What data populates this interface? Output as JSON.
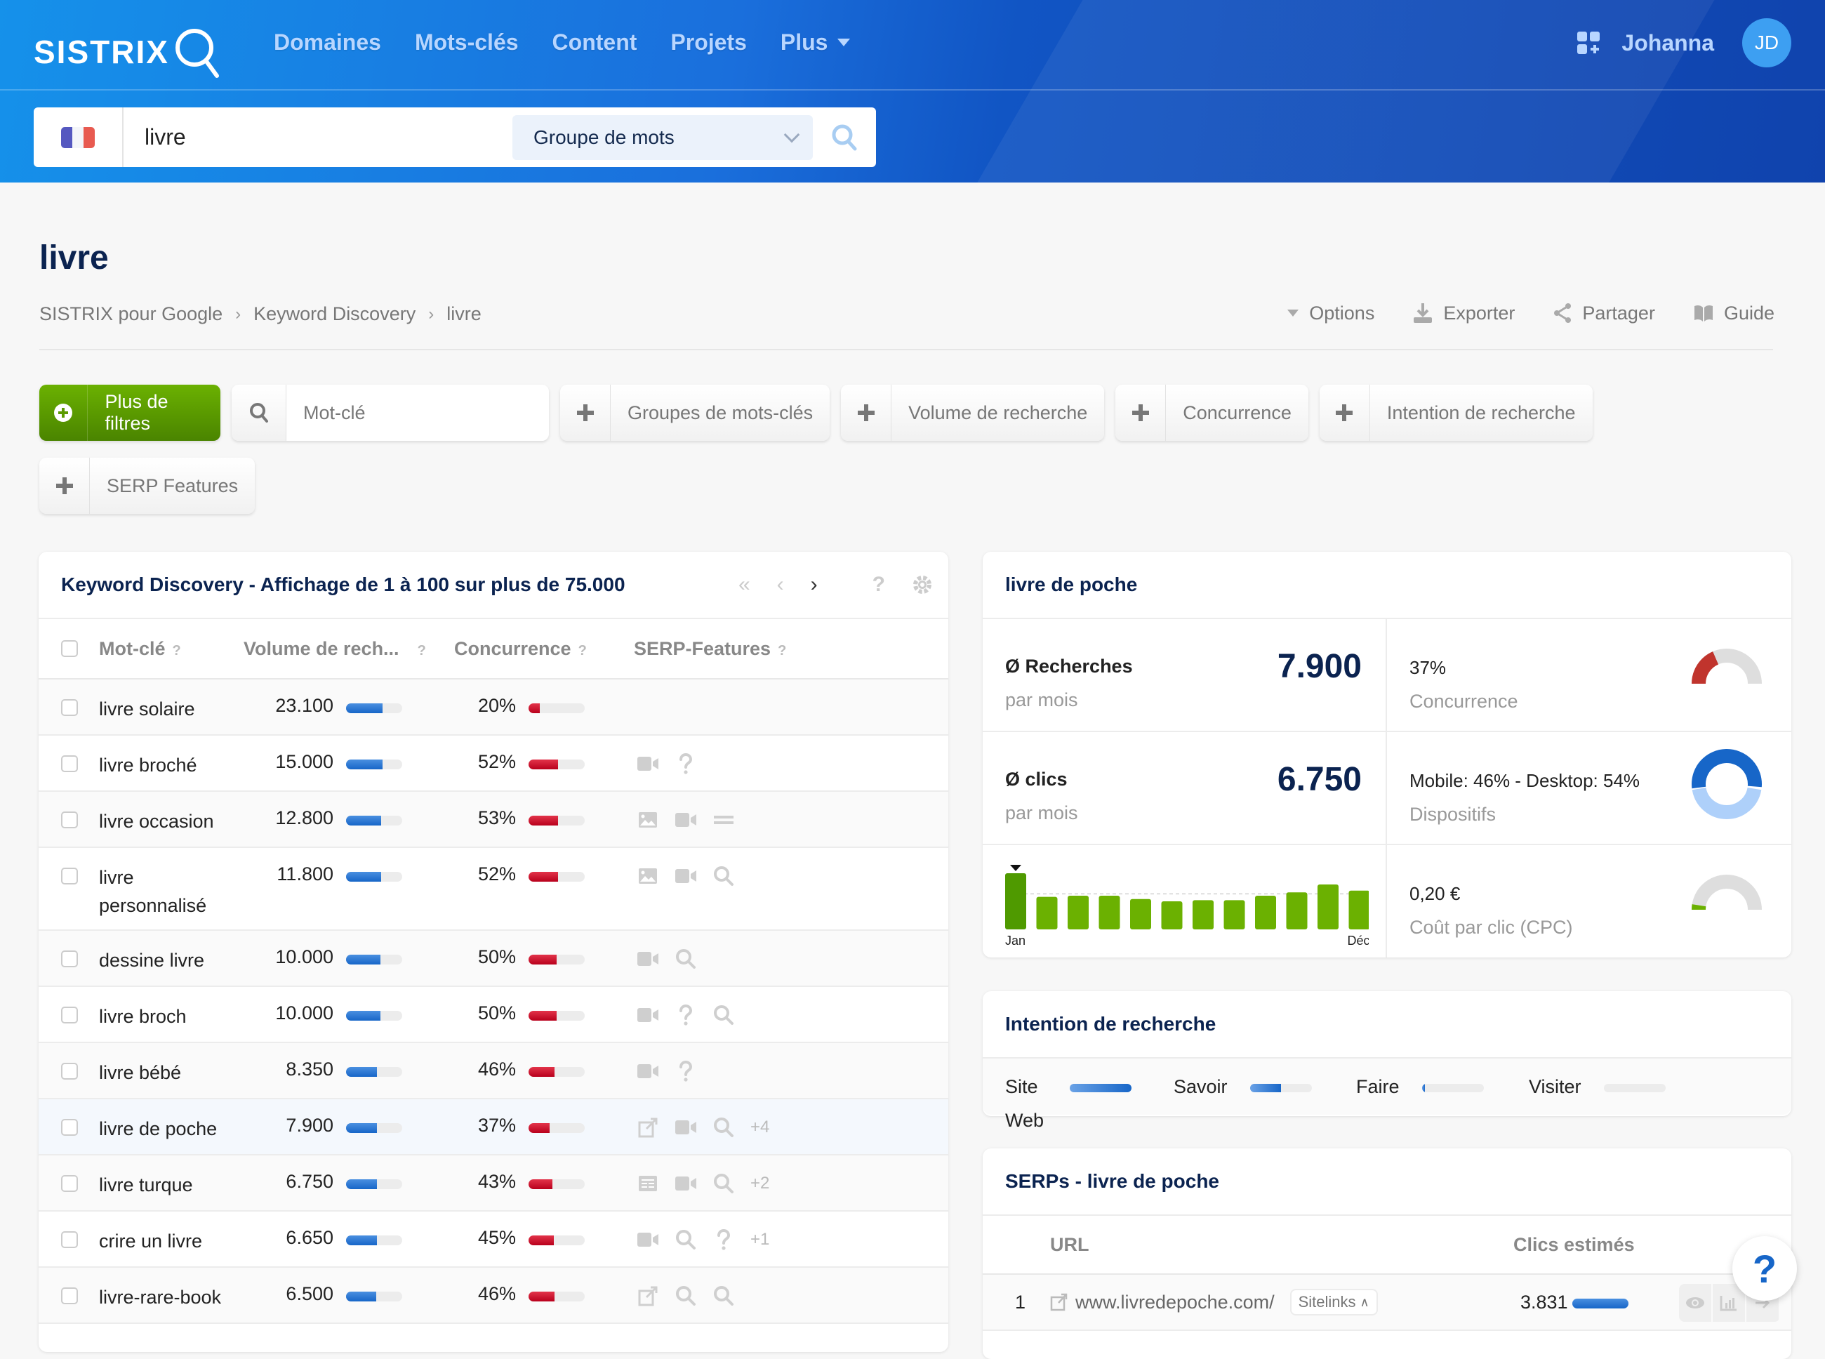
{
  "header": {
    "logo_text": "SISTRIX",
    "nav": [
      {
        "label": "Domaines"
      },
      {
        "label": "Mots-clés"
      },
      {
        "label": "Content"
      },
      {
        "label": "Projets"
      },
      {
        "label": "Plus",
        "has_dropdown": true
      }
    ],
    "user_name": "Johanna",
    "avatar_initials": "JD",
    "search": {
      "country": "France",
      "query": "livre",
      "mode": "Groupe de mots"
    }
  },
  "page": {
    "title": "livre",
    "breadcrumb": [
      "SISTRIX pour Google",
      "Keyword Discovery",
      "livre"
    ],
    "actions": [
      {
        "label": "Options",
        "icon": "caret-down-icon"
      },
      {
        "label": "Exporter",
        "icon": "download-icon"
      },
      {
        "label": "Partager",
        "icon": "share-icon"
      },
      {
        "label": "Guide",
        "icon": "book-icon"
      }
    ]
  },
  "filters": {
    "more_filters": "Plus de filtres",
    "keyword_placeholder": "Mot-clé",
    "chips": [
      "Groupes de mots-clés",
      "Volume de recherche",
      "Concurrence",
      "Intention de recherche",
      "SERP Features"
    ]
  },
  "keyword_table": {
    "title": "Keyword Discovery - Affichage de 1 à 100 sur plus de 75.000",
    "columns": [
      "Mot-clé",
      "Volume de rech...",
      "Concurrence",
      "SERP-Features"
    ],
    "rows": [
      {
        "keyword": "livre solaire",
        "volume": "23.100",
        "volume_fill": 0.65,
        "competition": "20%",
        "competition_value": 20,
        "features": [],
        "more": ""
      },
      {
        "keyword": "livre broché",
        "volume": "15.000",
        "volume_fill": 0.65,
        "competition": "52%",
        "competition_value": 52,
        "features": [
          "video",
          "question"
        ],
        "more": ""
      },
      {
        "keyword": "livre occasion",
        "volume": "12.800",
        "volume_fill": 0.62,
        "competition": "53%",
        "competition_value": 53,
        "features": [
          "image",
          "video",
          "list"
        ],
        "more": ""
      },
      {
        "keyword": "livre personnalisé",
        "volume": "11.800",
        "volume_fill": 0.62,
        "competition": "52%",
        "competition_value": 52,
        "features": [
          "image",
          "video",
          "search"
        ],
        "more": ""
      },
      {
        "keyword": "dessine livre",
        "volume": "10.000",
        "volume_fill": 0.61,
        "competition": "50%",
        "competition_value": 50,
        "features": [
          "video",
          "search"
        ],
        "more": ""
      },
      {
        "keyword": "livre broch",
        "volume": "10.000",
        "volume_fill": 0.61,
        "competition": "50%",
        "competition_value": 50,
        "features": [
          "video",
          "question",
          "search"
        ],
        "more": ""
      },
      {
        "keyword": "livre bébé",
        "volume": "8.350",
        "volume_fill": 0.55,
        "competition": "46%",
        "competition_value": 46,
        "features": [
          "video",
          "question"
        ],
        "more": ""
      },
      {
        "keyword": "livre de poche",
        "volume": "7.900",
        "volume_fill": 0.55,
        "competition": "37%",
        "competition_value": 37,
        "features": [
          "external-link",
          "video",
          "search"
        ],
        "more": "+4",
        "highlighted": true
      },
      {
        "keyword": "livre turque",
        "volume": "6.750",
        "volume_fill": 0.55,
        "competition": "43%",
        "competition_value": 43,
        "features": [
          "table",
          "video",
          "search"
        ],
        "more": "+2"
      },
      {
        "keyword": "crire un livre",
        "volume": "6.650",
        "volume_fill": 0.55,
        "competition": "45%",
        "competition_value": 45,
        "features": [
          "video",
          "search",
          "question"
        ],
        "more": "+1"
      },
      {
        "keyword": "livre-rare-book",
        "volume": "6.500",
        "volume_fill": 0.54,
        "competition": "46%",
        "competition_value": 46,
        "features": [
          "external-link",
          "search",
          "search"
        ],
        "more": ""
      }
    ]
  },
  "keyword_card": {
    "title": "livre de poche",
    "searches_label": "Ø Recherches",
    "searches_sub": "par mois",
    "searches_value": "7.900",
    "clicks_label": "Ø clics",
    "clicks_sub": "par mois",
    "clicks_value": "6.750",
    "competition_value": "37%",
    "competition_label": "Concurrence",
    "competition_pct": 37,
    "devices_value": "Mobile: 46% - Desktop: 54%",
    "devices_label": "Dispositifs",
    "mobile_pct": 46,
    "desktop_pct": 54,
    "cpc_value": "0,20 €",
    "cpc_label": "Coût par clic (CPC)",
    "cpc_gauge_pct": 5,
    "seasonality": {
      "start_label": "Jan",
      "end_label": "Déc",
      "highlighted_month": 0,
      "relative_values": [
        100,
        58,
        60,
        60,
        54,
        50,
        52,
        52,
        60,
        66,
        80,
        69
      ]
    }
  },
  "search_intent": {
    "title": "Intention de recherche",
    "items": [
      {
        "label": "Site Web",
        "value": 100
      },
      {
        "label": "Savoir",
        "value": 50
      },
      {
        "label": "Faire",
        "value": 5
      },
      {
        "label": "Visiter",
        "value": 0
      }
    ]
  },
  "serps": {
    "title": "SERPs - livre de poche",
    "columns": [
      "URL",
      "Clics estimés"
    ],
    "rows": [
      {
        "position": "1",
        "url": "www.livredepoche.com/",
        "badge": "Sitelinks",
        "clicks": "3.831",
        "clicks_fill": 1.0
      }
    ]
  },
  "help_button": "?",
  "colors": {
    "brand_blue": "#1766c8",
    "accent_green": "#6bb101",
    "competition_red": "#c8102e",
    "title_navy": "#0b2350"
  }
}
